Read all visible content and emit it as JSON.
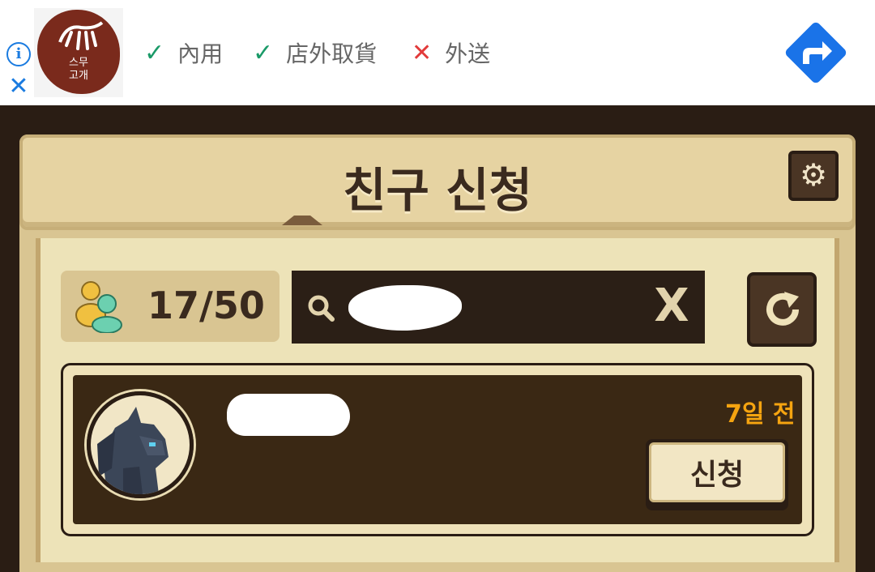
{
  "ad": {
    "logo_text_line1": "스무",
    "logo_text_line2": "고개",
    "features": [
      {
        "mark": "✓",
        "label": "內用",
        "available": true
      },
      {
        "mark": "✓",
        "label": "店外取貨",
        "available": true
      },
      {
        "mark": "✕",
        "label": "外送",
        "available": false
      }
    ],
    "info_icon": "info-icon",
    "close_icon": "close-icon",
    "directions_icon": "directions-icon"
  },
  "header": {
    "title": "친구 신청",
    "settings_icon": "gear-icon"
  },
  "toolbar": {
    "friend_count": "17/50",
    "search_value": "",
    "clear_label": "X",
    "refresh_icon": "refresh-icon"
  },
  "requests": [
    {
      "name": "",
      "time_ago": "7일 전",
      "action_label": "신청"
    }
  ],
  "colors": {
    "accent": "#f5a410",
    "panel": "#e6d3a2",
    "dark": "#2b1f16"
  }
}
